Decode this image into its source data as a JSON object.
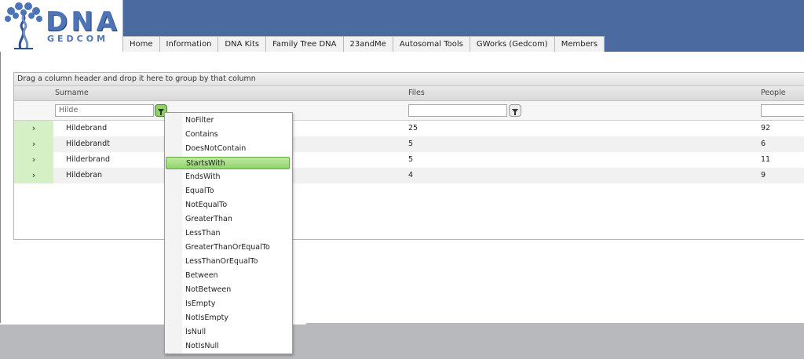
{
  "logo": {
    "title": "DNA",
    "subtitle": "GEDCOM"
  },
  "nav": [
    "Home",
    "Information",
    "DNA Kits",
    "Family Tree DNA",
    "23andMe",
    "Autosomal Tools",
    "GWorks (Gedcom)",
    "Members"
  ],
  "grid": {
    "group_hint": "Drag a column header and drop it here to group by that column",
    "columns": {
      "surname": "Surname",
      "files": "Files",
      "people": "People"
    },
    "filter": {
      "surname_value": "Hilde",
      "files_value": "",
      "people_value": ""
    },
    "rows": [
      {
        "expander": "›",
        "surname": "Hildebrand",
        "files": "25",
        "people": "92"
      },
      {
        "expander": "›",
        "surname": "Hildebrandt",
        "files": "5",
        "people": "6"
      },
      {
        "expander": "›",
        "surname": "Hilderbrand",
        "files": "5",
        "people": "11"
      },
      {
        "expander": "›",
        "surname": "Hildebran",
        "files": "4",
        "people": "9"
      }
    ]
  },
  "filter_menu": {
    "selected": "StartsWith",
    "options": [
      "NoFilter",
      "Contains",
      "DoesNotContain",
      "StartsWith",
      "EndsWith",
      "EqualTo",
      "NotEqualTo",
      "GreaterThan",
      "LessThan",
      "GreaterThanOrEqualTo",
      "LessThanOrEqualTo",
      "Between",
      "NotBetween",
      "IsEmpty",
      "NotIsEmpty",
      "IsNull",
      "NotIsNull"
    ]
  },
  "colors": {
    "header_bg": "#4a6aa0",
    "accent_green": "#8fd46b",
    "expander_bg": "#d6f0c6"
  },
  "icons": {
    "filter": "funnel-icon",
    "expander": "chevron-right-icon",
    "logo": "dna-tree-icon"
  }
}
